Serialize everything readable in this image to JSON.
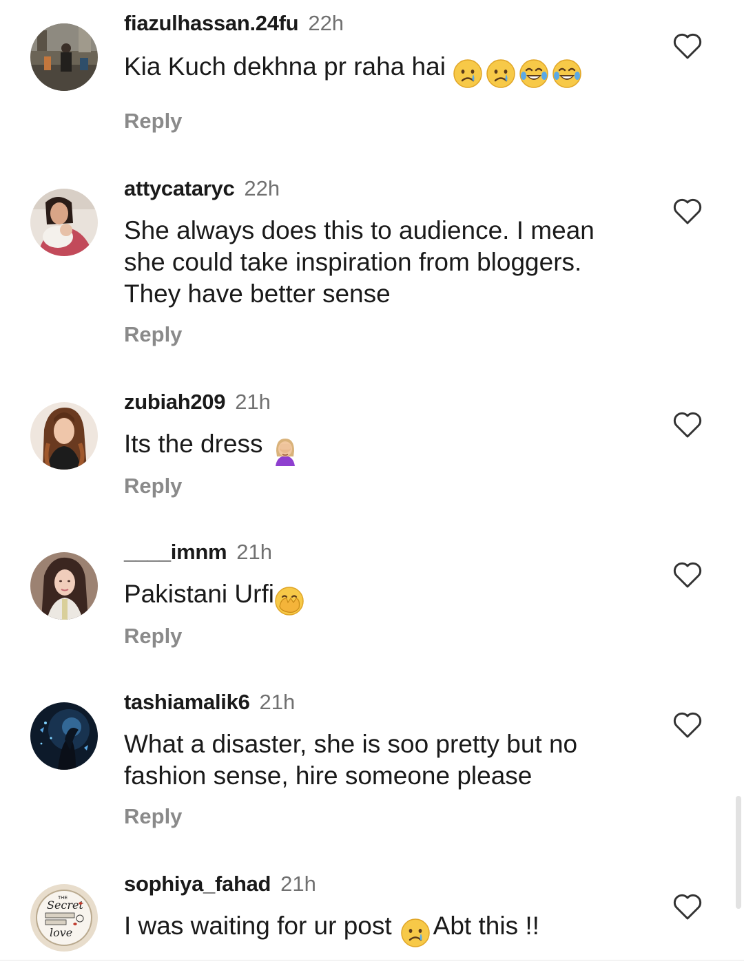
{
  "comments": [
    {
      "username": "fiazulhassan.24fu",
      "time": "22h",
      "text_lines": [
        "Kia Kuch dekhna pr raha hai"
      ],
      "emojis": [
        "crying-face",
        "crying-face",
        "tears-of-joy",
        "tears-of-joy"
      ],
      "reply_label": "Reply",
      "avatar": "photo-street-scene"
    },
    {
      "username": "attycataryc",
      "time": "22h",
      "text_lines": [
        "She always does this to audience. I mean",
        "she could take inspiration from bloggers.",
        "They have better sense"
      ],
      "emojis": [],
      "reply_label": "Reply",
      "avatar": "photo-woman-with-baby"
    },
    {
      "username": "zubiah209",
      "time": "21h",
      "text_lines": [
        "Its the dress"
      ],
      "emojis": [
        "woman-facepalming"
      ],
      "reply_label": "Reply",
      "avatar": "photo-woman-long-hair"
    },
    {
      "username": "____imnm",
      "time": "21h",
      "text_lines": [
        "Pakistani Urfi"
      ],
      "emojis": [
        "face-with-hand-over-mouth"
      ],
      "reply_label": "Reply",
      "avatar": "photo-woman-selfie"
    },
    {
      "username": "tashiamalik6",
      "time": "21h",
      "text_lines": [
        "What a disaster, she is soo pretty but no",
        "fashion sense, hire someone please"
      ],
      "emojis": [],
      "reply_label": "Reply",
      "avatar": "art-dark-fantasy"
    },
    {
      "username": "sophiya_fahad",
      "time": "21h",
      "text_lines": [
        "I was waiting for ur post"
      ],
      "emojis": [
        "crying-face"
      ],
      "text_after_emoji": "Abt this !!",
      "reply_label": "",
      "avatar": "art-secret-love-badge"
    }
  ],
  "avatar_badge_text": {
    "line1": "THE",
    "line2": "Secret",
    "line3": "love"
  },
  "colors": {
    "username": "#1a1a1a",
    "timestamp": "#707070",
    "reply": "#8a8a8a",
    "heart_outline": "#333333"
  },
  "icons": {
    "like": "heart-outline-icon"
  }
}
